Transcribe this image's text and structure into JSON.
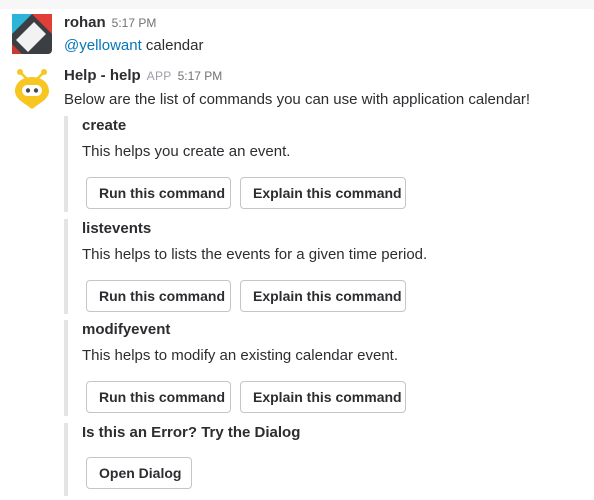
{
  "messages": [
    {
      "author": "rohan",
      "time": "5:17 PM",
      "avatar": "rohan-avatar-icon",
      "text_mention": "@yellowant",
      "text_rest": " calendar"
    },
    {
      "author": "Help - help",
      "app_tag": "APP",
      "time": "5:17 PM",
      "avatar": "yellowant-bot-icon",
      "text": "Below are the list of commands you can use with application calendar!",
      "attachments": [
        {
          "title": "create",
          "text": "This helps you create an event.",
          "buttons": [
            "Run this command",
            "Explain this command"
          ]
        },
        {
          "title": "listevents",
          "text": "This helps to lists the events for a given time period.",
          "buttons": [
            "Run this command",
            "Explain this command"
          ]
        },
        {
          "title": "modifyevent",
          "text": "This helps to modify an existing calendar event.",
          "buttons": [
            "Run this command",
            "Explain this command"
          ]
        },
        {
          "title": "Is this an Error? Try the Dialog",
          "buttons": [
            "Open Dialog"
          ]
        }
      ]
    }
  ],
  "colors": {
    "text": "#2c2d30",
    "mention": "#0576b9",
    "muted": "#717274",
    "attachment_border": "#e3e4e6",
    "bot_yellow": "#f7c623"
  }
}
